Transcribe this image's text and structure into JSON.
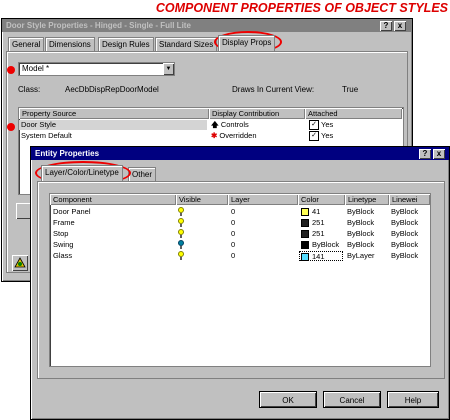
{
  "banner": {
    "text": "COMPONENT PROPERTIES OF OBJECT STYLES"
  },
  "back_window": {
    "title": "Door Style Properties - Hinged - Single - Full Lite",
    "title_buttons": [
      "?",
      "x"
    ],
    "tabs": [
      "General",
      "Dimensions",
      "Design Rules",
      "Standard Sizes",
      "Display Props"
    ],
    "selected_tab": "Display Props",
    "dropdown_value": "Model *",
    "class_label": "Class:",
    "class_value": "AecDbDispRepDoorModel",
    "draws_label": "Draws In Current View:",
    "draws_value": "True",
    "table": {
      "headers": [
        "Property Source",
        "Display Contribution",
        "Attached"
      ],
      "rows": [
        {
          "source": "Door Style",
          "contribution": "Controls",
          "attached": "Yes",
          "selected": true
        },
        {
          "source": "System Default",
          "contribution": "Overridden",
          "attached": "Yes",
          "selected": false
        }
      ]
    }
  },
  "front_window": {
    "title": "Entity Properties",
    "title_buttons": [
      "?",
      "x"
    ],
    "tabs": [
      "Layer/Color/Linetype",
      "Other"
    ],
    "selected_tab": "Layer/Color/Linetype",
    "table": {
      "headers": [
        "Component",
        "Visible",
        "Layer",
        "Color",
        "Linetype",
        "Linewei"
      ],
      "rows": [
        {
          "component": "Door Panel",
          "visible": "on",
          "layer": "0",
          "color_swatch": "#ffff55",
          "color": "41",
          "linetype": "ByBlock",
          "lineweight": "ByBlock"
        },
        {
          "component": "Frame",
          "visible": "on",
          "layer": "0",
          "color_swatch": "#202020",
          "color": "251",
          "linetype": "ByBlock",
          "lineweight": "ByBlock"
        },
        {
          "component": "Stop",
          "visible": "on",
          "layer": "0",
          "color_swatch": "#202020",
          "color": "251",
          "linetype": "ByBlock",
          "lineweight": "ByBlock"
        },
        {
          "component": "Swing",
          "visible": "off",
          "layer": "0",
          "color_swatch": "#000000",
          "color": "ByBlock",
          "linetype": "ByBlock",
          "lineweight": "ByBlock"
        },
        {
          "component": "Glass",
          "visible": "on",
          "layer": "0",
          "color_swatch": "#55ddff",
          "color": "141",
          "linetype": "ByLayer",
          "lineweight": "ByBlock"
        }
      ]
    },
    "buttons": {
      "ok": "OK",
      "cancel": "Cancel",
      "help": "Help"
    }
  },
  "colors": {
    "title_active": "#000080",
    "title_inactive": "#808080",
    "annotation_red": "#ee0000",
    "dialog_face": "#c0c0c0"
  }
}
